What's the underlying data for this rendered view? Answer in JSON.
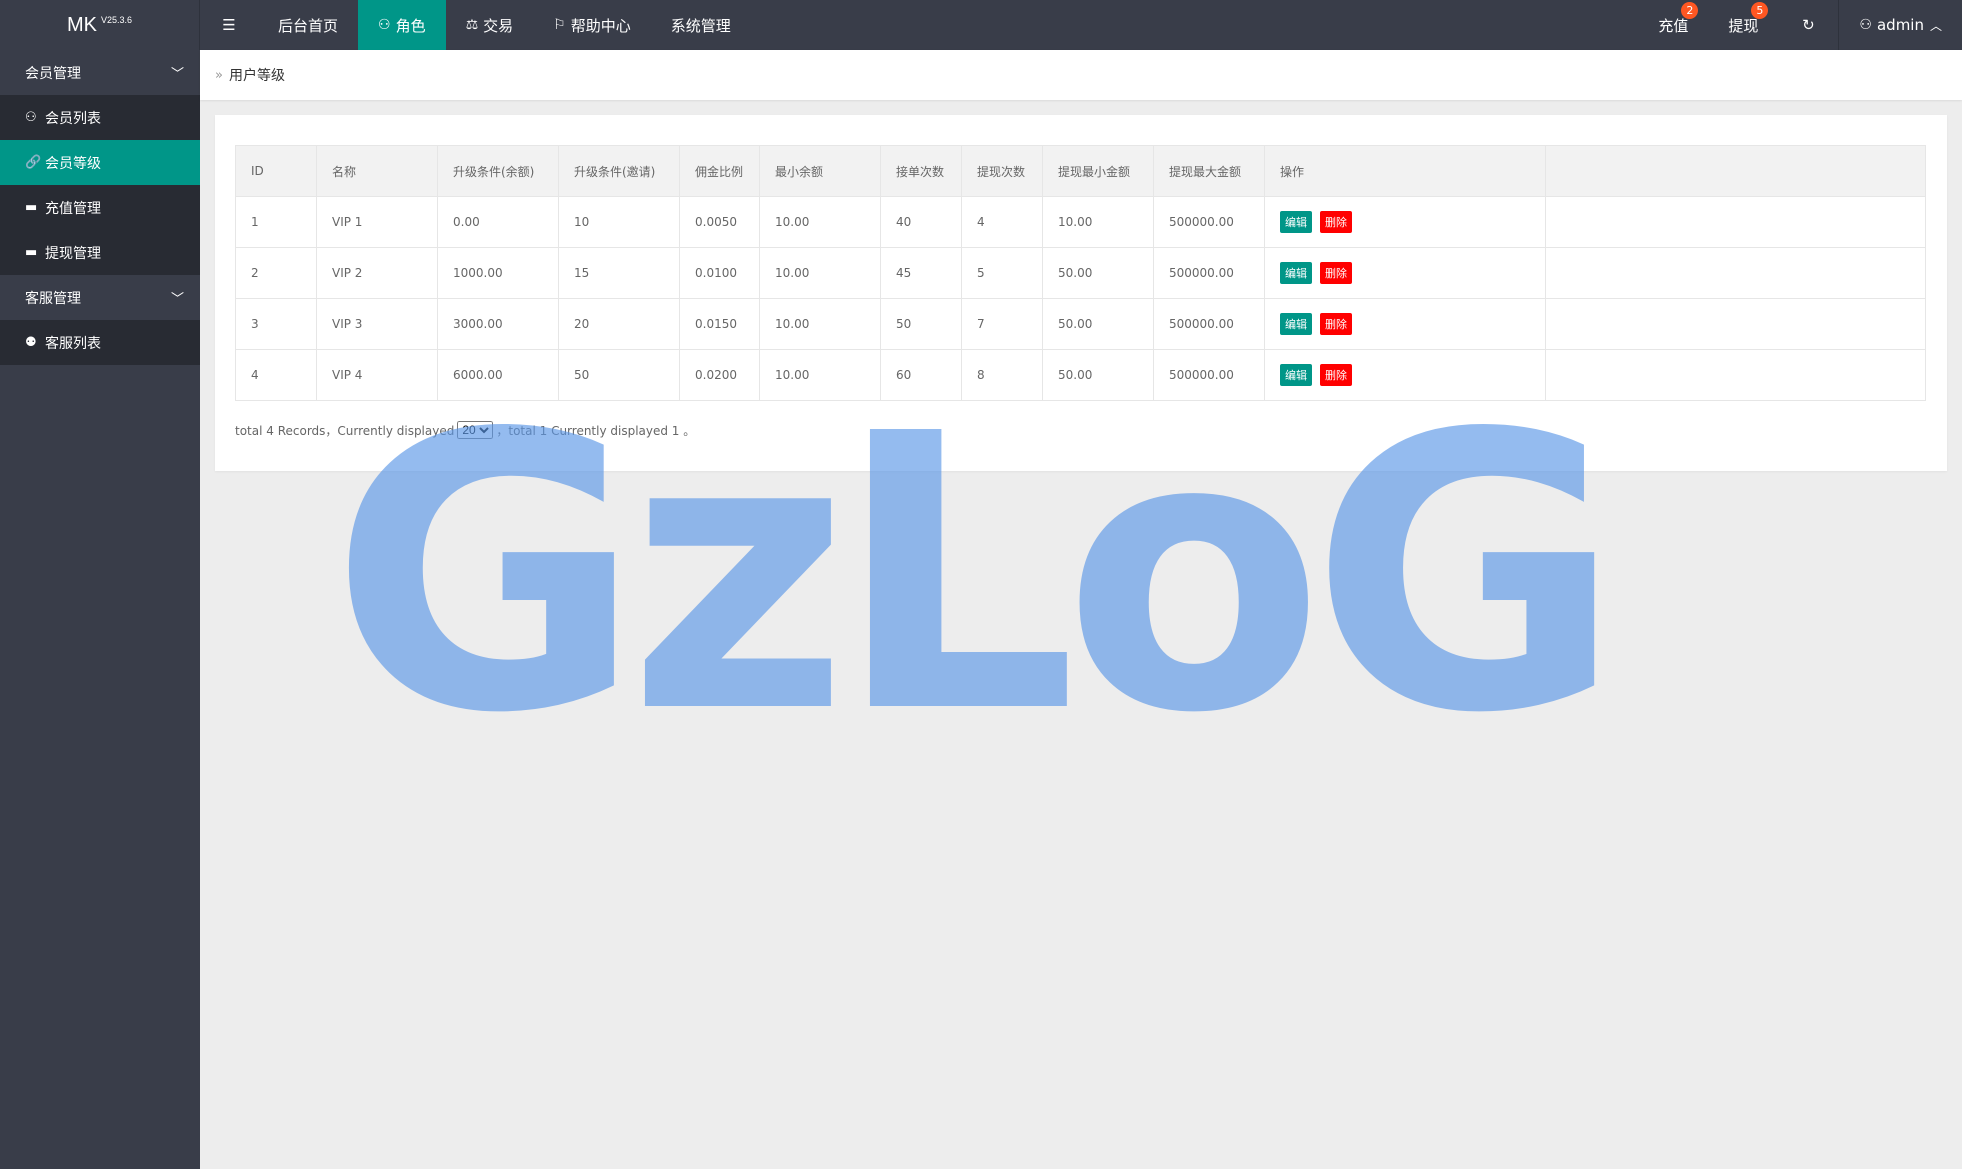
{
  "app": {
    "logo": "MK",
    "version": "V25.3.6"
  },
  "topnav": {
    "items": [
      {
        "label": "后台首页"
      },
      {
        "label": "角色"
      },
      {
        "label": "交易"
      },
      {
        "label": "帮助中心"
      },
      {
        "label": "系统管理"
      }
    ],
    "active_index": 1
  },
  "topright": {
    "recharge": {
      "label": "充值",
      "badge": "2"
    },
    "withdraw": {
      "label": "提现",
      "badge": "5"
    },
    "user": {
      "label": "admin"
    }
  },
  "sidebar": {
    "groups": [
      {
        "label": "会员管理",
        "items": [
          {
            "label": "会员列表",
            "icon": "user-icon"
          },
          {
            "label": "会员等级",
            "icon": "link-icon",
            "active": true
          },
          {
            "label": "充值管理",
            "icon": "card-icon"
          },
          {
            "label": "提现管理",
            "icon": "card-icon"
          }
        ]
      },
      {
        "label": "客服管理",
        "items": [
          {
            "label": "客服列表",
            "icon": "users-icon"
          }
        ]
      }
    ]
  },
  "breadcrumb": {
    "label": "用户等级"
  },
  "table": {
    "headers": [
      "ID",
      "名称",
      "升级条件(余额)",
      "升级条件(邀请)",
      "佣金比例",
      "最小余额",
      "接单次数",
      "提现次数",
      "提现最小金额",
      "提现最大金额",
      "操作"
    ],
    "rows": [
      [
        "1",
        "VIP 1",
        "0.00",
        "10",
        "0.0050",
        "10.00",
        "40",
        "4",
        "10.00",
        "500000.00"
      ],
      [
        "2",
        "VIP 2",
        "1000.00",
        "15",
        "0.0100",
        "10.00",
        "45",
        "5",
        "50.00",
        "500000.00"
      ],
      [
        "3",
        "VIP 3",
        "3000.00",
        "20",
        "0.0150",
        "10.00",
        "50",
        "7",
        "50.00",
        "500000.00"
      ],
      [
        "4",
        "VIP 4",
        "6000.00",
        "50",
        "0.0200",
        "10.00",
        "60",
        "8",
        "50.00",
        "500000.00"
      ]
    ],
    "edit_label": "编辑",
    "delete_label": "删除"
  },
  "pager": {
    "prefix": "total 4 Records，Currently displayed",
    "page_size": "20",
    "suffix": "，total 1 Currently displayed 1 。"
  },
  "watermark": {
    "text": "GzLoG"
  },
  "colors": {
    "topbar": "#393d49",
    "accent": "#009688",
    "danger": "#ff0000",
    "badge": "#ff5722"
  }
}
